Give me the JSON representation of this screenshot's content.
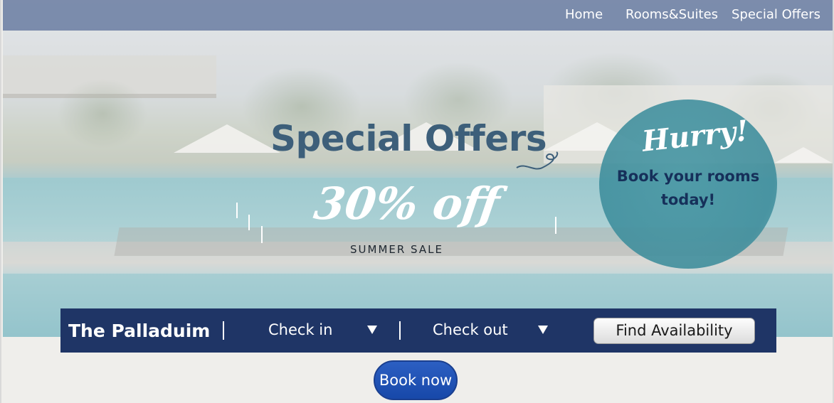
{
  "nav": {
    "items": [
      "Home",
      "Rooms&Suites",
      "Special Offers"
    ]
  },
  "hero": {
    "headline": "Special Offers",
    "discount": "30% off",
    "sale_label": "SUMMER SALE"
  },
  "badge": {
    "hurry": "Hurry!",
    "line1": "Book your rooms",
    "line2": "today!"
  },
  "booking_bar": {
    "brand": "The Palladuim",
    "check_in": "Check in",
    "check_out": "Check out",
    "find_button": "Find Availability"
  },
  "cta": {
    "book_now": "Book now"
  },
  "colors": {
    "nav_bg": "#7082a5",
    "headline": "#3d5f7a",
    "badge_teal": "#4a98a5",
    "booking_bar_bg": "#1f3566",
    "book_now_bg": "#1f52b5"
  },
  "icons": {
    "dropdown": "chevron-down-icon",
    "swirl": "swirl-decoration-icon"
  }
}
